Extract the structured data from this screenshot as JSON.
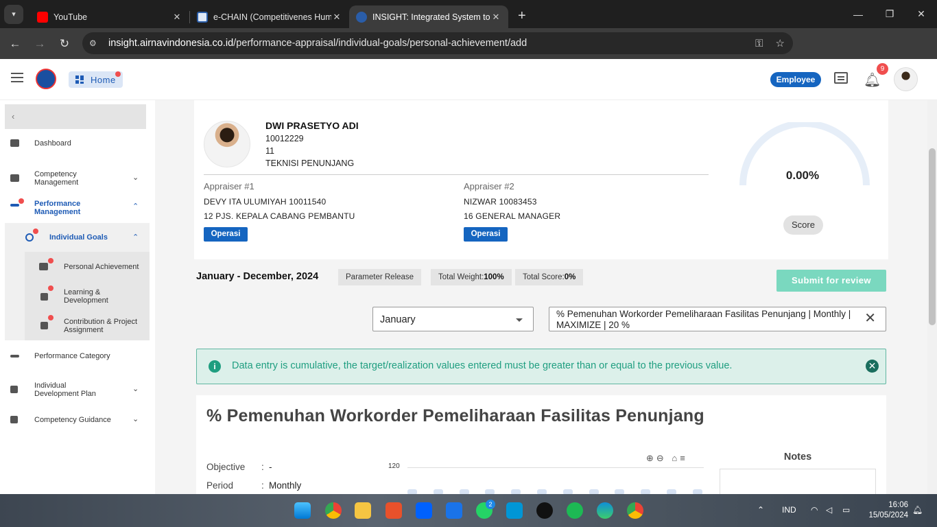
{
  "browser": {
    "tabs": [
      {
        "title": "YouTube",
        "active": false
      },
      {
        "title": "e-CHAIN (Competitivenes Human",
        "active": false
      },
      {
        "title": "INSIGHT: Integrated System to",
        "active": true
      }
    ],
    "url_host": "insight.airnavindonesia.co.id",
    "url_path": "/performance-appraisal/individual-goals/personal-achievement/add"
  },
  "header": {
    "home_label": "Home",
    "role_label": "Employee",
    "notification_count": "9"
  },
  "sidebar": {
    "items": [
      {
        "label": "Dashboard"
      },
      {
        "label": "Competency Management"
      },
      {
        "label": "Performance Management"
      },
      {
        "label": "Individual Goals"
      },
      {
        "label": "Personal Achievement"
      },
      {
        "label": "Learning & Development"
      },
      {
        "label": "Contribution & Project Assignment"
      },
      {
        "label": "Performance Category"
      },
      {
        "label": "Individual Development Plan"
      },
      {
        "label": "Competency Guidance"
      }
    ]
  },
  "profile": {
    "name": "DWI PRASETYO ADI",
    "id": "10012229",
    "grade": "11",
    "position": "TEKNISI PENUNJANG",
    "score_value": "0.00%",
    "score_label": "Score",
    "appraiser1": {
      "heading": "Appraiser #1",
      "name": "DEVY ITA ULUMIYAH 10011540",
      "role": "12 PJS. KEPALA CABANG PEMBANTU",
      "unit": "Operasi"
    },
    "appraiser2": {
      "heading": "Appraiser #2",
      "name": "NIZWAR 10083453",
      "role": "16 GENERAL MANAGER",
      "unit": "Operasi"
    }
  },
  "summary": {
    "period": "January - December, 2024",
    "parameter_release": "Parameter Release",
    "total_weight_label": "Total Weight:",
    "total_weight_value": "100%",
    "total_score_label": "Total Score:",
    "total_score_value": "0%",
    "submit_label": "Submit for review"
  },
  "filters": {
    "month": "January",
    "goal": "% Pemenuhan Workorder Pemeliharaan Fasilitas Penunjang | Monthly | MAXIMIZE | 20 %"
  },
  "alert": {
    "message": "Data entry is cumulative, the target/realization values entered must be greater than or equal to the previous value."
  },
  "detail": {
    "title": "% Pemenuhan Workorder Pemeliharaan Fasilitas Penunjang",
    "objective_label": "Objective",
    "objective_value": "-",
    "period_label": "Period",
    "period_value": "Monthly",
    "chart_ymax_label": "120",
    "notes_title": "Notes"
  },
  "taskbar": {
    "language": "IND",
    "time": "16:06",
    "date": "15/05/2024",
    "whatsapp_badge": "2"
  },
  "colors": {
    "brand_blue": "#1565c0",
    "alert_green": "#1f9e80",
    "submit_green": "#7ad8bf",
    "notif_red": "#f04e4e"
  }
}
